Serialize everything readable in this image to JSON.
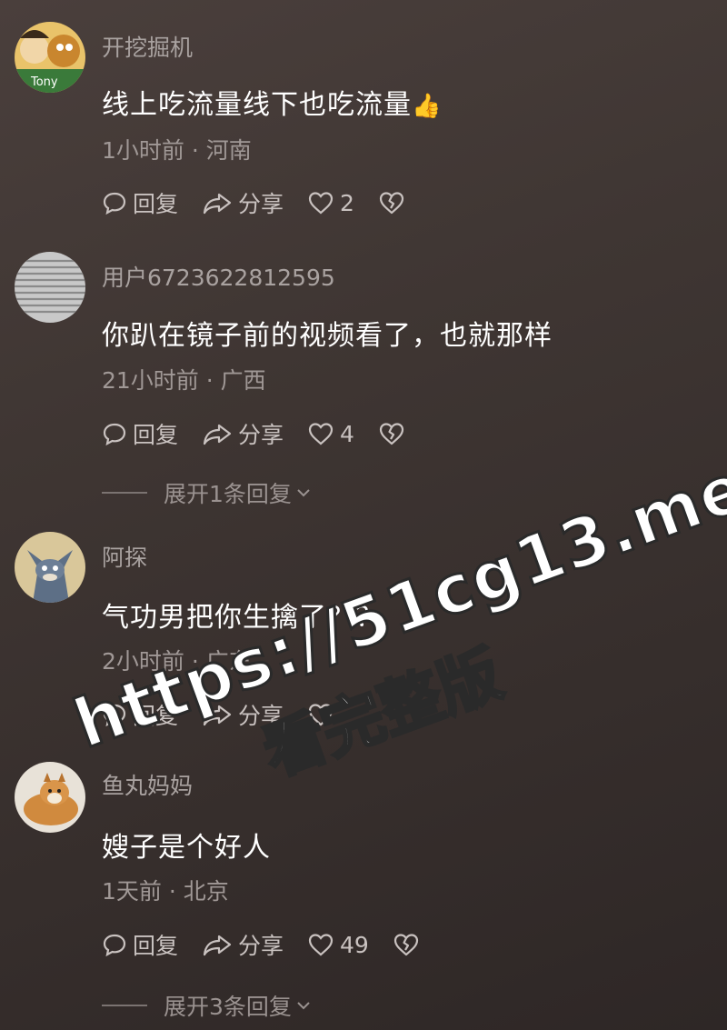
{
  "comments": [
    {
      "username": "开挖掘机",
      "text": "线上吃流量线下也吃流量",
      "emoji": "👍",
      "meta": "1小时前 · 河南",
      "reply_label": "回复",
      "share_label": "分享",
      "likes": "2"
    },
    {
      "username": "用户6723622812595",
      "text": "你趴在镜子前的视频看了，也就那样",
      "meta": "21小时前 · 广西",
      "reply_label": "回复",
      "share_label": "分享",
      "likes": "4",
      "expand": "展开1条回复"
    },
    {
      "username": "阿探",
      "text": "气功男把你生擒了？？",
      "meta": "2小时前 · 广东",
      "reply_label": "回复",
      "share_label": "分享",
      "likes": ""
    },
    {
      "username": "鱼丸妈妈",
      "text": "嫂子是个好人",
      "meta": "1天前 · 北京",
      "reply_label": "回复",
      "share_label": "分享",
      "likes": "49",
      "expand": "展开3条回复"
    }
  ],
  "watermark": {
    "url": "https://51cg13.me",
    "sub": "看完整版"
  },
  "avatars": {
    "c1_label": "Tony"
  }
}
